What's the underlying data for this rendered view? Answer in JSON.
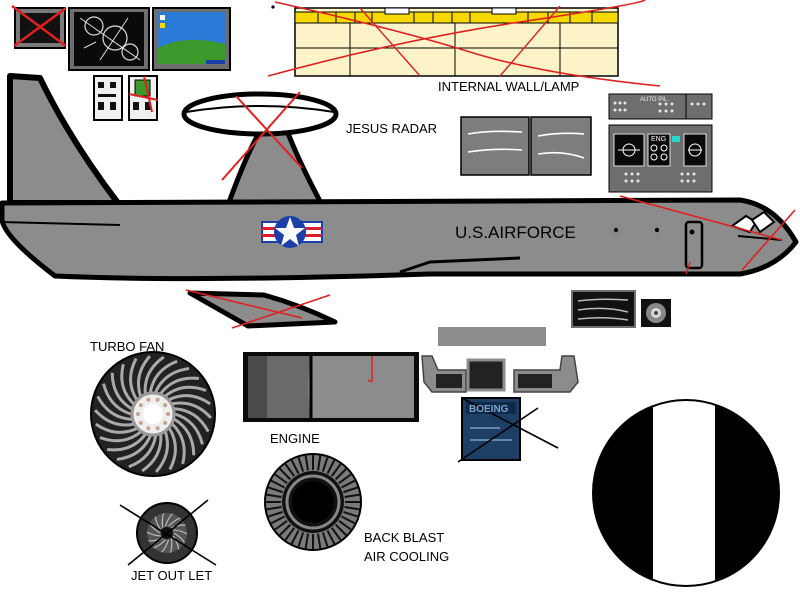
{
  "labels": {
    "internal_wall_lamp": "INTERNAL WALL/LAMP",
    "jesus_radar": "JESUS RADAR",
    "us_airforce": "U.S.AIRFORCE",
    "turbo_fan": "TURBO FAN",
    "engine": "ENGINE",
    "back_blast_line1": "BACK BLAST",
    "back_blast_line2": "AIR COOLING",
    "jet_outlet": "JET OUT LET",
    "autopilot_panel": "AUTO PIL.",
    "eng_display": "ENG",
    "boeing_manual": "BOEING"
  },
  "colors": {
    "fuselage": "#8c8c8c",
    "outline": "#000000",
    "crossout": "#e02020",
    "ceiling_panel": "#fdf3c8",
    "lamp_strip": "#f5d800",
    "roundel_red": "#d91e2e",
    "roundel_blue": "#1a3fa8",
    "manual_blue": "#1d3f66",
    "desktop_sky": "#2a7ad8",
    "desktop_grass": "#3c9a2c"
  },
  "icons": [
    "roundel-icon",
    "radar-dome-icon",
    "turbo-fan-icon",
    "engine-icon",
    "exhaust-ring-icon",
    "jet-outlet-icon",
    "manual-book-icon",
    "monitor-icon",
    "radar-screen-icon",
    "desktop-screen-icon",
    "switch-panel-icon",
    "cockpit-panel-icon",
    "headphones-icon",
    "black-white-disc-icon"
  ]
}
